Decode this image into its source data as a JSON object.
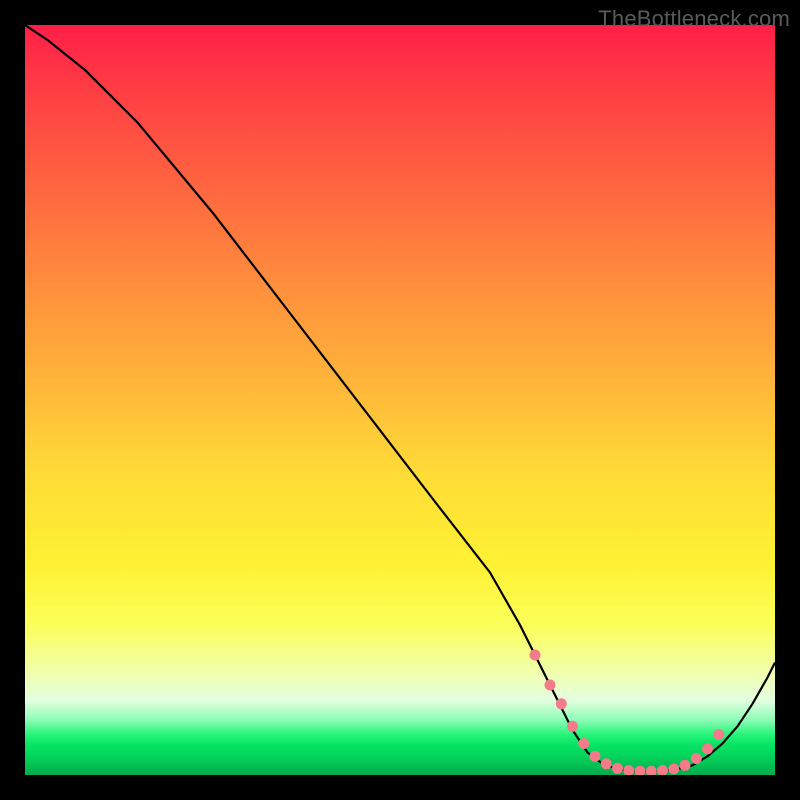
{
  "watermark": "TheBottleneck.com",
  "colors": {
    "curve": "#000000",
    "dot_fill": "#f47b8a",
    "dot_stroke": "#f47b8a"
  },
  "chart_data": {
    "type": "line",
    "title": "",
    "xlabel": "",
    "ylabel": "",
    "xlim": [
      0,
      100
    ],
    "ylim": [
      0,
      100
    ],
    "series": [
      {
        "name": "bottleneck-curve",
        "x": [
          0,
          3,
          8,
          15,
          25,
          35,
          45,
          55,
          62,
          66,
          68,
          70,
          72,
          73,
          75,
          77,
          79,
          81,
          83,
          85,
          87,
          89,
          91,
          93,
          95,
          97,
          99,
          100
        ],
        "y": [
          100,
          98,
          94,
          87,
          75,
          62,
          49,
          36,
          27,
          20,
          16,
          12,
          8,
          6,
          3,
          1.5,
          0.8,
          0.5,
          0.5,
          0.6,
          0.8,
          1.3,
          2.5,
          4.2,
          6.5,
          9.5,
          13,
          15
        ]
      }
    ],
    "dots": {
      "x": [
        68,
        70,
        71.5,
        73,
        74.5,
        76,
        77.5,
        79,
        80.5,
        82,
        83.5,
        85,
        86.5,
        88,
        89.5,
        91,
        92.5
      ],
      "y": [
        16,
        12,
        9.5,
        6.5,
        4.2,
        2.5,
        1.5,
        0.9,
        0.6,
        0.5,
        0.5,
        0.6,
        0.8,
        1.3,
        2.2,
        3.5,
        5.4
      ]
    }
  }
}
